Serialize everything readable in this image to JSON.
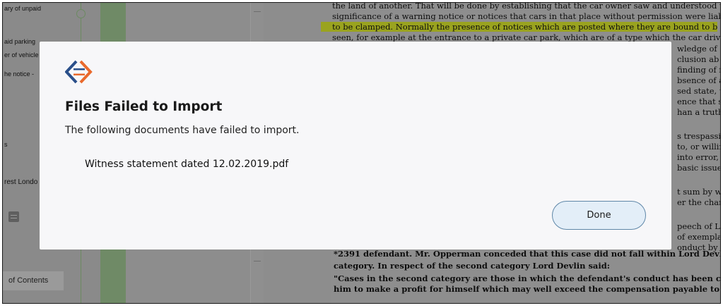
{
  "left_panel": {
    "items": [
      "ary of unpaid",
      "aid parking",
      "er of vehicle",
      "he notice -",
      "s",
      "rest Londo"
    ],
    "toc_label": "of Contents"
  },
  "document": {
    "lines": [
      "the land of another. That will be done by establishing that the car owner saw and understood the",
      "significance of a warning notice or notices that cars in that place without permission were liab",
      "to be clamped. Normally the presence of notices which are posted where they are bound to b",
      "seen, for example at the entrance to a private car park, which are of a type which the car drive"
    ],
    "right_fragments": [
      "wledge of a",
      "clusion ab",
      "finding of fa",
      "bsence of a",
      "sed state, t",
      "ence that s",
      "han a truth",
      "s trespassin",
      "to, or willin",
      "into error,",
      "basic issue",
      "t sum by w",
      "er the char",
      "peech of L",
      "of exemplar",
      "onduct by"
    ],
    "bottom_lines": [
      "*2391  defendant. Mr. Opperman conceded that this case did not fall within Lord Devlin's fi",
      "category. In respect of the second category Lord Devlin said:",
      "\"Cases in the second category are those in which the defendant's conduct has been calculated",
      "him to make a profit for himself which may well exceed the compensation payable to the plainti"
    ]
  },
  "modal": {
    "title": "Files Failed to Import",
    "message": "The following documents have failed to import.",
    "failed_files": [
      "Witness statement dated 12.02.2019.pdf"
    ],
    "done_label": "Done"
  },
  "colors": {
    "logo_blue": "#2a4f8a",
    "logo_orange": "#e9692c",
    "button_bg": "#e3eef8",
    "button_border": "#5f87a8"
  }
}
